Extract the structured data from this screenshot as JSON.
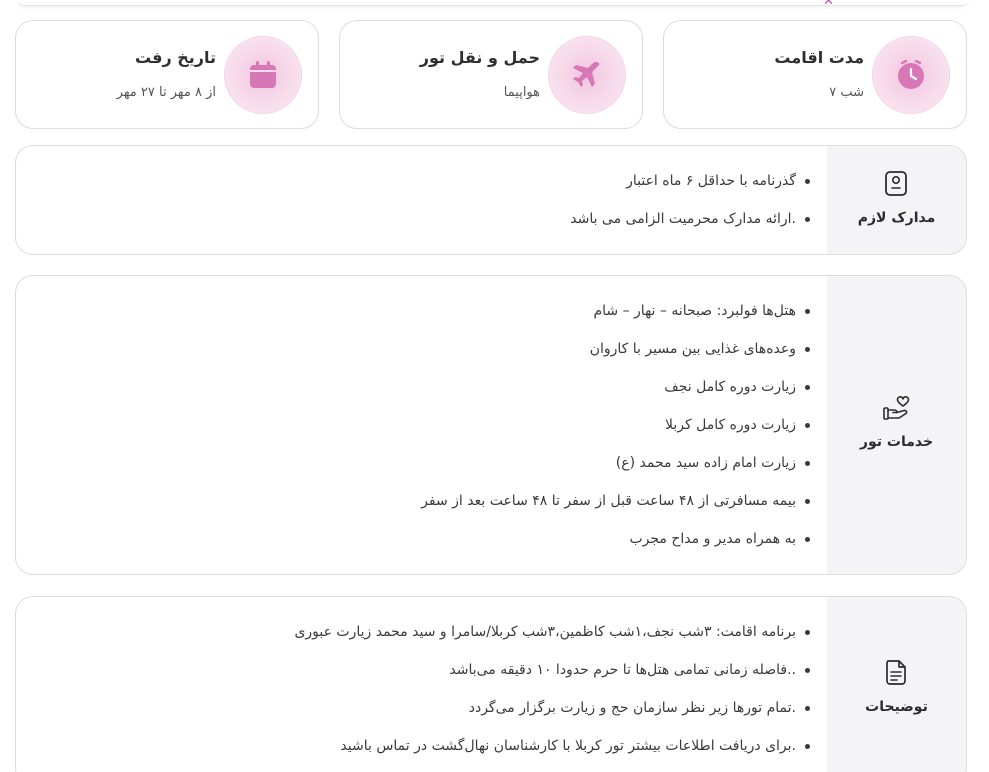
{
  "info_cards": [
    {
      "title": "مدت اقامت",
      "value": "۷ شب",
      "icon": "clock-icon"
    },
    {
      "title": "حمل و نقل تور",
      "value": "هواپیما",
      "icon": "airplane-icon"
    },
    {
      "title": "تاریخ رفت",
      "value": "از ۸ مهر تا ۲۷ مهر",
      "icon": "calendar-icon"
    }
  ],
  "sections": {
    "documents": {
      "label": "مدارک لازم",
      "icon": "passport-icon",
      "items": [
        "گذرنامه با حداقل ۶ ماه اعتبار",
        "ارائه مدارک محرمیت الزامی می باشد."
      ]
    },
    "services": {
      "label": "خدمات تور",
      "icon": "hand-heart-icon",
      "items": [
        "هتل‌ها فولبرد: صبحانه – نهار – شام",
        "وعده‌های غذایی بین مسیر با کاروان",
        "زیارت دوره کامل نجف",
        "زیارت دوره کامل کربلا",
        "زیارت امام زاده سید محمد (ع)",
        "بیمه مسافرتی از ۴۸ ساعت قبل از سفر تا ۴۸ ساعت بعد از سفر",
        "به همراه مدیر و مداح مجرب"
      ]
    },
    "notes": {
      "label": "توضیحات",
      "icon": "document-icon",
      "items": [
        "برنامه اقامت: ۳شب نجف،۱شب کاظمین،۳شب کربلا/سامرا و سید محمد زیارت عبوری",
        "فاصله زمانی تمامی هتل‌ها تا حرم حدودا ۱۰ دقیقه می‌باشد..",
        "تمام تورها زیر نظر سازمان حج و زیارت برگزار می‌گردد.",
        "برای دریافت اطلاعات بیشتر تور کربلا با کارشناسان نهال‌گشت در تماس باشید."
      ]
    }
  },
  "colors": {
    "accent": "#c94a9a",
    "icon_fill": "#d877b6",
    "side_bg": "#f4f4f6",
    "border": "#dcdcdc"
  }
}
